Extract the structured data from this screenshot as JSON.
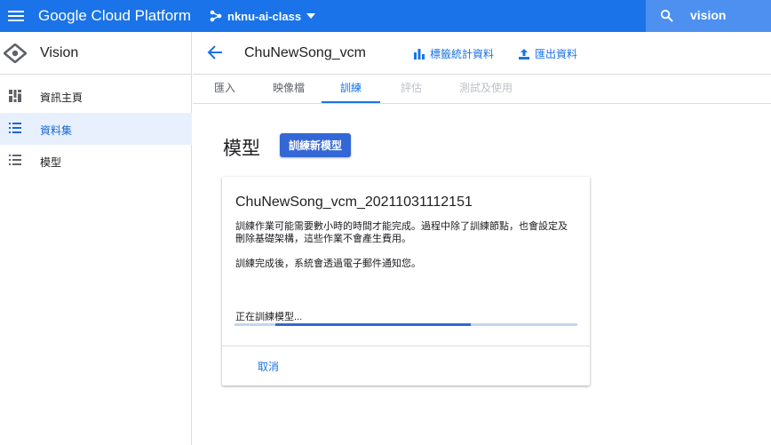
{
  "topbar": {
    "brand": "Google Cloud Platform",
    "project": "nknu-ai-class",
    "search_value": "vision",
    "icons": [
      "menu-icon",
      "project-hub-icon",
      "dropdown-caret-icon",
      "search-icon"
    ],
    "colors": {
      "bar": "#1a73e8",
      "search_bg": "#4d90f0"
    }
  },
  "sidebar": {
    "product_name": "Vision",
    "items": [
      {
        "label": "資訊主頁",
        "icon": "dashboard-icon",
        "active": false
      },
      {
        "label": "資料集",
        "icon": "list-icon",
        "active": true
      },
      {
        "label": "模型",
        "icon": "list-icon",
        "active": false
      }
    ]
  },
  "header": {
    "title": "ChuNewSong_vcm",
    "label_stats": "標籤統計資料",
    "export": "匯出資料"
  },
  "tabs": [
    {
      "label": "匯入",
      "state": "normal"
    },
    {
      "label": "映像檔",
      "state": "normal"
    },
    {
      "label": "訓練",
      "state": "active"
    },
    {
      "label": "評估",
      "state": "disabled"
    },
    {
      "label": "測試及使用",
      "state": "disabled"
    }
  ],
  "main": {
    "title": "模型",
    "train_button": "訓練新模型",
    "card": {
      "model_name": "ChuNewSong_vcm_20211031112151",
      "description": "訓練作業可能需要數小時的時間才能完成。過程中除了訓練節點，也會設定及刪除基礎架構，這些作業不會產生費用。",
      "notify": "訓練完成後，系統會透過電子郵件通知您。",
      "status": "正在訓練模型...",
      "progress": {
        "start": 0.12,
        "end": 0.69
      },
      "cancel": "取消"
    }
  }
}
